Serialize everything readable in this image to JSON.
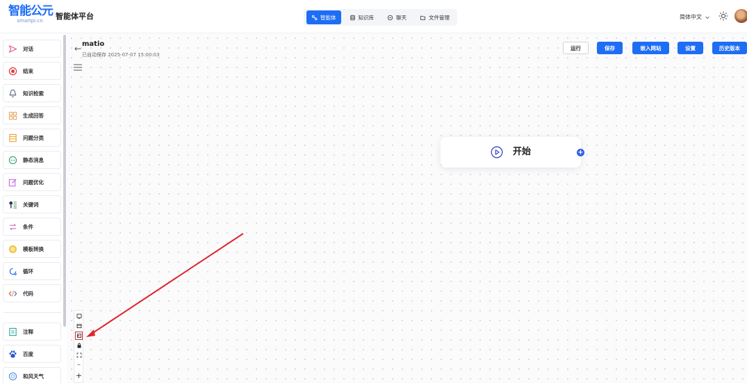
{
  "header": {
    "logo_text": "智能公元",
    "logo_sub": "smartpi.cn",
    "app_name": "智能体平台",
    "nav": [
      {
        "label": "智能体",
        "icon": "agent-icon",
        "active": true
      },
      {
        "label": "知识库",
        "icon": "database-icon",
        "active": false
      },
      {
        "label": "聊天",
        "icon": "chat-icon",
        "active": false
      },
      {
        "label": "文件管理",
        "icon": "folder-icon",
        "active": false
      }
    ],
    "language": "简体中文",
    "accent": "#1e6df5"
  },
  "sidebar": {
    "items": [
      {
        "label": "对话",
        "icon": "send-icon"
      },
      {
        "label": "结束",
        "icon": "stop-icon"
      },
      {
        "label": "知识检索",
        "icon": "knowledge-search-icon"
      },
      {
        "label": "生成回答",
        "icon": "generate-answer-icon"
      },
      {
        "label": "问题分类",
        "icon": "classify-icon"
      },
      {
        "label": "静态消息",
        "icon": "static-message-icon"
      },
      {
        "label": "问题优化",
        "icon": "edit-icon"
      },
      {
        "label": "关键词",
        "icon": "keyword-icon"
      },
      {
        "label": "条件",
        "icon": "condition-icon"
      },
      {
        "label": "模板转换",
        "icon": "template-icon"
      },
      {
        "label": "循环",
        "icon": "loop-icon"
      },
      {
        "label": "代码",
        "icon": "code-icon"
      },
      {
        "label": "注释",
        "icon": "note-icon"
      },
      {
        "label": "百度",
        "icon": "baidu-icon"
      },
      {
        "label": "和风天气",
        "icon": "weather-icon"
      }
    ]
  },
  "flow": {
    "title": "matio",
    "saved_text": "已自动保存 2025-07-07 15:00:03"
  },
  "toolbar": {
    "run": "运行",
    "save": "保存",
    "embed": "嵌入网站",
    "settings": "设置",
    "history": "历史版本"
  },
  "node": {
    "label": "开始",
    "icon": "play-circle-icon"
  },
  "controls": [
    {
      "name": "minimap-icon",
      "glyph": ""
    },
    {
      "name": "collapse-icon",
      "glyph": ""
    },
    {
      "name": "import-icon",
      "glyph": ""
    },
    {
      "name": "lock-icon",
      "glyph": ""
    },
    {
      "name": "fit-view-icon",
      "glyph": ""
    },
    {
      "name": "zoom-out-icon",
      "glyph": "−"
    },
    {
      "name": "zoom-in-icon",
      "glyph": "+"
    }
  ]
}
